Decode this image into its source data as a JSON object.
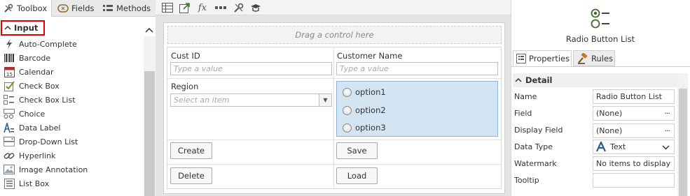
{
  "left_panel": {
    "tabs": [
      {
        "label": "Toolbox",
        "icon": "toolbox-icon"
      },
      {
        "label": "Fields",
        "icon": "fields-icon"
      },
      {
        "label": "Methods",
        "icon": "methods-icon"
      }
    ],
    "group_label": "Input",
    "tools": [
      {
        "label": "Auto-Complete",
        "icon": "lightning-icon"
      },
      {
        "label": "Barcode",
        "icon": "barcode-icon"
      },
      {
        "label": "Calendar",
        "icon": "calendar-icon"
      },
      {
        "label": "Check Box",
        "icon": "checkbox-icon"
      },
      {
        "label": "Check Box List",
        "icon": "checkbox-list-icon"
      },
      {
        "label": "Choice",
        "icon": "choice-icon"
      },
      {
        "label": "Data Label",
        "icon": "data-label-icon"
      },
      {
        "label": "Drop-Down List",
        "icon": "dropdown-list-icon"
      },
      {
        "label": "Hyperlink",
        "icon": "hyperlink-icon"
      },
      {
        "label": "Image Annotation",
        "icon": "image-annotation-icon"
      },
      {
        "label": "List Box",
        "icon": "list-box-icon"
      }
    ]
  },
  "toolbar": {
    "icons": [
      "table-icon",
      "export-icon",
      "function-icon",
      "more-icon",
      "tools-icon",
      "hat-icon"
    ]
  },
  "canvas": {
    "drop_hint": "Drag a control here",
    "fields": {
      "cust_id_label": "Cust ID",
      "cust_id_placeholder": "Type a value",
      "customer_name_label": "Customer Name",
      "customer_name_placeholder": "Type a value",
      "region_label": "Region",
      "region_placeholder": "Select an item"
    },
    "radio_options": [
      "option1",
      "option2",
      "option3"
    ],
    "buttons": {
      "create": "Create",
      "save": "Save",
      "delete": "Delete",
      "load": "Load"
    }
  },
  "right_panel": {
    "control_title": "Radio Button List",
    "tabs": {
      "properties": "Properties",
      "rules": "Rules"
    },
    "section": "Detail",
    "properties": [
      {
        "label": "Name",
        "value": "Radio Button List"
      },
      {
        "label": "Field",
        "value": "(None)"
      },
      {
        "label": "Display Field",
        "value": "(None)"
      },
      {
        "label": "Data Type",
        "value": "Text"
      },
      {
        "label": "Watermark",
        "value": "No items to display"
      },
      {
        "label": "Tooltip",
        "value": ""
      }
    ]
  },
  "colors": {
    "highlight_border": "#e00000",
    "radio_panel_bg": "#d3e4f3",
    "data_type_icon": "#2c5f8a"
  }
}
